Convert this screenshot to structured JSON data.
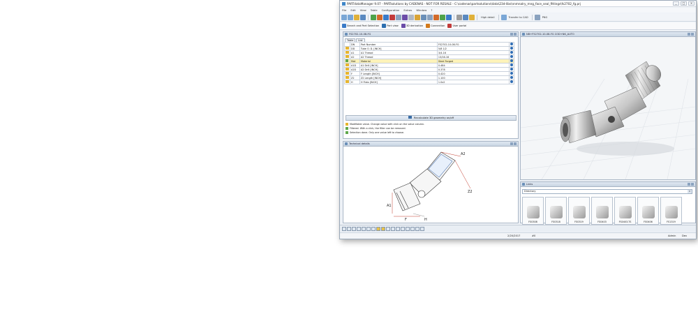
{
  "window": {
    "title": "PARTdataManager 9.07 - PARTsolutions by CADENAS - NOT FOR RESALE - C:\\cadenas\\partsolutions\\data\\23d-libs\\nnmnalry_mng_face_seal_fittings\\fs2702_fg.prj",
    "buttons": [
      "_",
      "□",
      "×"
    ]
  },
  "menu": [
    "File",
    "Edit",
    "View",
    "Table",
    "Configuration",
    "Extras",
    "Window",
    "?"
  ],
  "toolbar": {
    "detail_label": "High detail",
    "transfer_label": "Transfer to CAD",
    "format_label": "PNG"
  },
  "toolbar2": [
    {
      "label": "Search and Part Selection",
      "icon": "search-icon",
      "color": "#3a7bc8"
    },
    {
      "label": "Part view",
      "icon": "part-view-icon",
      "color": "#2d6fb0"
    },
    {
      "label": "3D derivation",
      "icon": "derivation-icon",
      "color": "#6a4ca8"
    },
    {
      "label": "Connection",
      "icon": "connection-icon",
      "color": "#d27a1c"
    },
    {
      "label": "User portal",
      "icon": "user-portal-icon",
      "color": "#c23b3b"
    }
  ],
  "table_panel": {
    "title": "FS2702-10-08-FG",
    "tabs": [
      "Table",
      "List"
    ],
    "rows": [
      {
        "code": "DN",
        "name": "Part Number",
        "value": "FS2702-10-08-FG",
        "icon": "none"
      },
      {
        "code": "DD",
        "name": "Tube O. D. [INCH]",
        "value": "5/8 1/2",
        "icon": "pencil"
      },
      {
        "code": "A1",
        "name": "A1 Thread",
        "value": "3/4-16",
        "icon": "pencil"
      },
      {
        "code": "A2",
        "name": "A2 Thread",
        "value": "13/16-16",
        "icon": "pencil"
      },
      {
        "code": "Mat",
        "name": "Material",
        "value": "Steel Forged",
        "icon": "check"
      },
      {
        "code": "A1D",
        "name": "A1 Drill [INCH]",
        "value": "0.484",
        "icon": "pencil"
      },
      {
        "code": "A2D",
        "name": "A2 Drill [INCH]",
        "value": "0.378",
        "icon": "pencil"
      },
      {
        "code": "F",
        "name": "F Length [INCH]",
        "value": "0.420",
        "icon": "pencil"
      },
      {
        "code": "Z2",
        "name": "Z2 Length [INCH]",
        "value": "1.100",
        "icon": "pencil"
      },
      {
        "code": "H",
        "name": "H Flats [INCH]",
        "value": "1.0x2",
        "icon": "pencil"
      }
    ],
    "recalc_label": "Recalculate 3D geometry on/off",
    "legend": [
      "Modifiable value. Change value with click on the value column.",
      "Filtered. With a click, the filter can be removed.",
      "Selection done. Only one value left to choose."
    ]
  },
  "view3d_panel": {
    "title": "NB+F52702-10-08-FG COD+NK_AUTO"
  },
  "technical_panel": {
    "title": "Technical details",
    "labels": {
      "a1": "A1",
      "a2": "A2",
      "z2": "Z2",
      "f": "F",
      "h": "H"
    }
  },
  "links_panel": {
    "title": "Links",
    "dropdown": "Directory",
    "items": [
      "FS0308",
      "FS0318",
      "FS0319",
      "FS0403",
      "FS0403-TS",
      "FS0406",
      "FS1319"
    ]
  },
  "status": {
    "date": "2/20/2017",
    "count": "#0",
    "user": "Admin",
    "mode": "Dev"
  },
  "colors": {
    "accent": "#3a7bc8",
    "highlight_row": "#fdf3b9",
    "pencil": "#e7b52e",
    "check": "#5fa84b",
    "info": "#2f6db5",
    "dimension": "#c0392b"
  }
}
